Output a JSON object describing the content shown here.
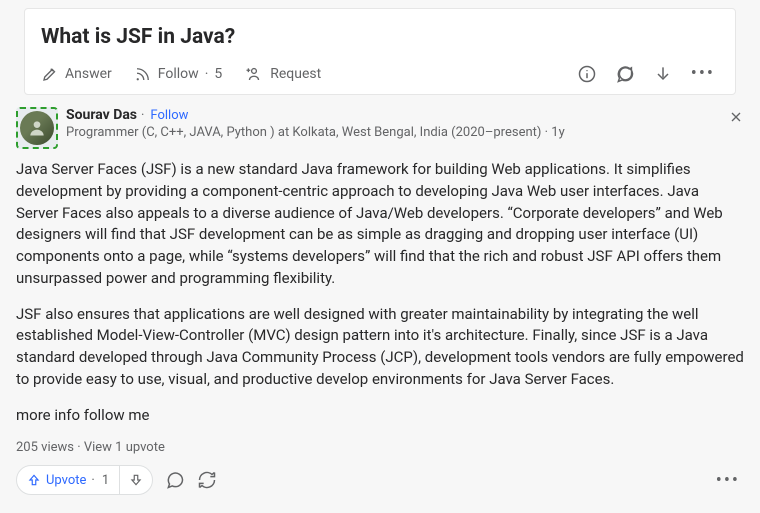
{
  "question": {
    "title": "What is JSF in Java?",
    "actions": {
      "answer": "Answer",
      "follow": "Follow",
      "follow_count": "5",
      "request": "Request"
    }
  },
  "answer": {
    "author": {
      "name": "Sourav Das",
      "follow_label": "Follow",
      "credentials": "Programmer (C, C++, JAVA, Python ) at Kolkata, West Bengal, India (2020–present)",
      "time": "1y"
    },
    "paragraphs": {
      "p1": "Java Server Faces (JSF) is a new standard Java framework for building Web applications. It simplifies development by providing a component-centric approach to developing Java Web user interfaces. Java Server Faces also appeals to a diverse audience of Java/Web developers. “Corporate developers” and Web designers will find that JSF development can be as simple as dragging and dropping user interface (UI) components onto a page, while “systems developers” will find that the rich and robust JSF API offers them unsurpassed power and programming flexibility.",
      "p2": "JSF also ensures that applications are well designed with greater maintainability by integrating the well established Model-View-Controller (MVC) design pattern into it's architecture. Finally, since JSF is a Java standard developed through Java Community Process (JCP), development tools vendors are fully empowered to provide easy to use, visual, and productive develop environments for Java Server Faces.",
      "p3": "more info follow me"
    },
    "stats": {
      "views": "205 views",
      "upvote_views": "View 1 upvote"
    },
    "footer": {
      "upvote_label": "Upvote",
      "upvote_count": "1"
    }
  }
}
